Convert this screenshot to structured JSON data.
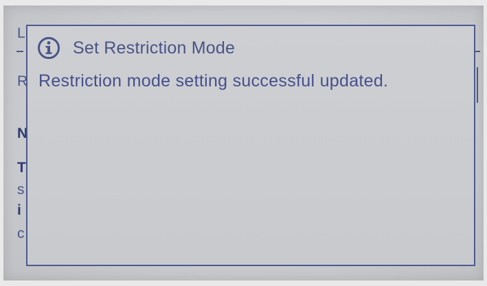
{
  "dialog": {
    "icon": "info-icon",
    "title": "Set Restriction Mode",
    "message": "Restriction mode setting successful updated."
  },
  "background_fragments": {
    "f1": "L",
    "f2": "R",
    "f3": "N",
    "f4": "T",
    "f5": "s",
    "f6": "i",
    "f7": "c"
  },
  "colors": {
    "text": "#4a5487",
    "border": "#4c5a8e",
    "screen": "#cbcdd1"
  }
}
